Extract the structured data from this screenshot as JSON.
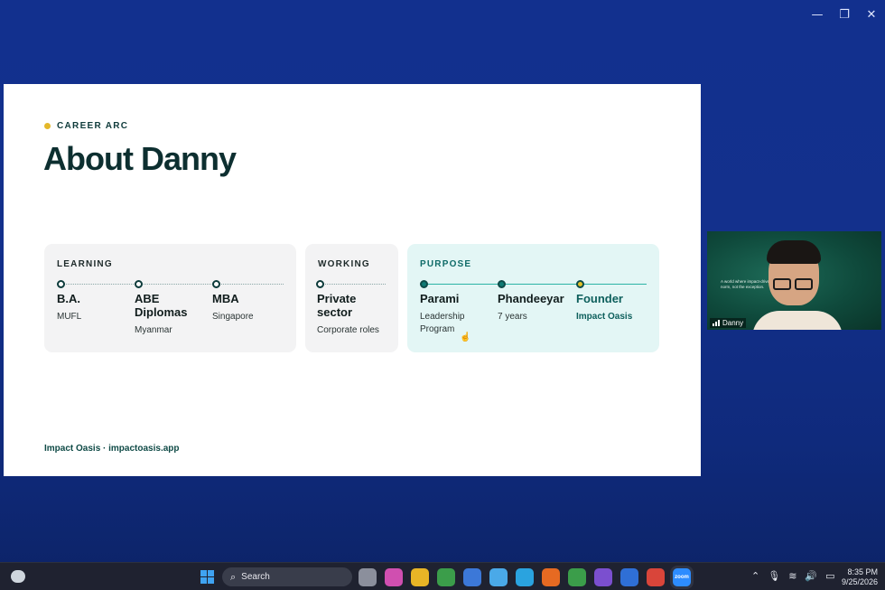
{
  "window": {
    "minimize": "—",
    "restore": "❐",
    "close": "✕"
  },
  "slide": {
    "eyebrow": "CAREER ARC",
    "title": "About Danny",
    "footer": "Impact Oasis · impactoasis.app",
    "accent_color": "#e4b82a",
    "teal_color": "#0f7a74",
    "cards": {
      "learning": {
        "label": "LEARNING",
        "steps": [
          {
            "title": "B.A.",
            "sub": "MUFL"
          },
          {
            "title": "ABE Diplomas",
            "sub": "Myanmar"
          },
          {
            "title": "MBA",
            "sub": "Singapore"
          }
        ]
      },
      "working": {
        "label": "WORKING",
        "steps": [
          {
            "title": "Private sector",
            "sub": "Corporate roles"
          }
        ]
      },
      "purpose": {
        "label": "PURPOSE",
        "steps": [
          {
            "title": "Parami",
            "sub": "Leadership Program"
          },
          {
            "title": "Phandeeyar",
            "sub": "7 years"
          },
          {
            "title": "Founder",
            "sub": "Impact Oasis"
          }
        ]
      }
    }
  },
  "video": {
    "participant_name": "Danny",
    "caption": "A world where impact-driven p... are the norm, not the exception."
  },
  "taskbar": {
    "search_label": "Search",
    "apps": [
      {
        "icon": "task-view-icon",
        "color": "#8b8f9c"
      },
      {
        "icon": "copilot-icon",
        "color": "#d04fb0"
      },
      {
        "icon": "file-explorer-icon",
        "color": "#e8b526"
      },
      {
        "icon": "chrome-icon",
        "color": "#3b9d4a"
      },
      {
        "icon": "store-icon",
        "color": "#3c78d8"
      },
      {
        "icon": "copilot-pwa-icon",
        "color": "#4aa9e8"
      },
      {
        "icon": "telegram-icon",
        "color": "#2aa3df"
      },
      {
        "icon": "firefox-icon",
        "color": "#e66a22"
      },
      {
        "icon": "chrome-profile-icon",
        "color": "#3b9d4a"
      },
      {
        "icon": "viber-icon",
        "color": "#7b4fcf"
      },
      {
        "icon": "bitwarden-icon",
        "color": "#2f6fd6"
      },
      {
        "icon": "chrome-alt-icon",
        "color": "#d9453a"
      },
      {
        "icon": "zoom-icon",
        "color": "#2d8cff",
        "label": "zoom"
      }
    ],
    "time": "8:35 PM",
    "date": "9/25/2026"
  }
}
